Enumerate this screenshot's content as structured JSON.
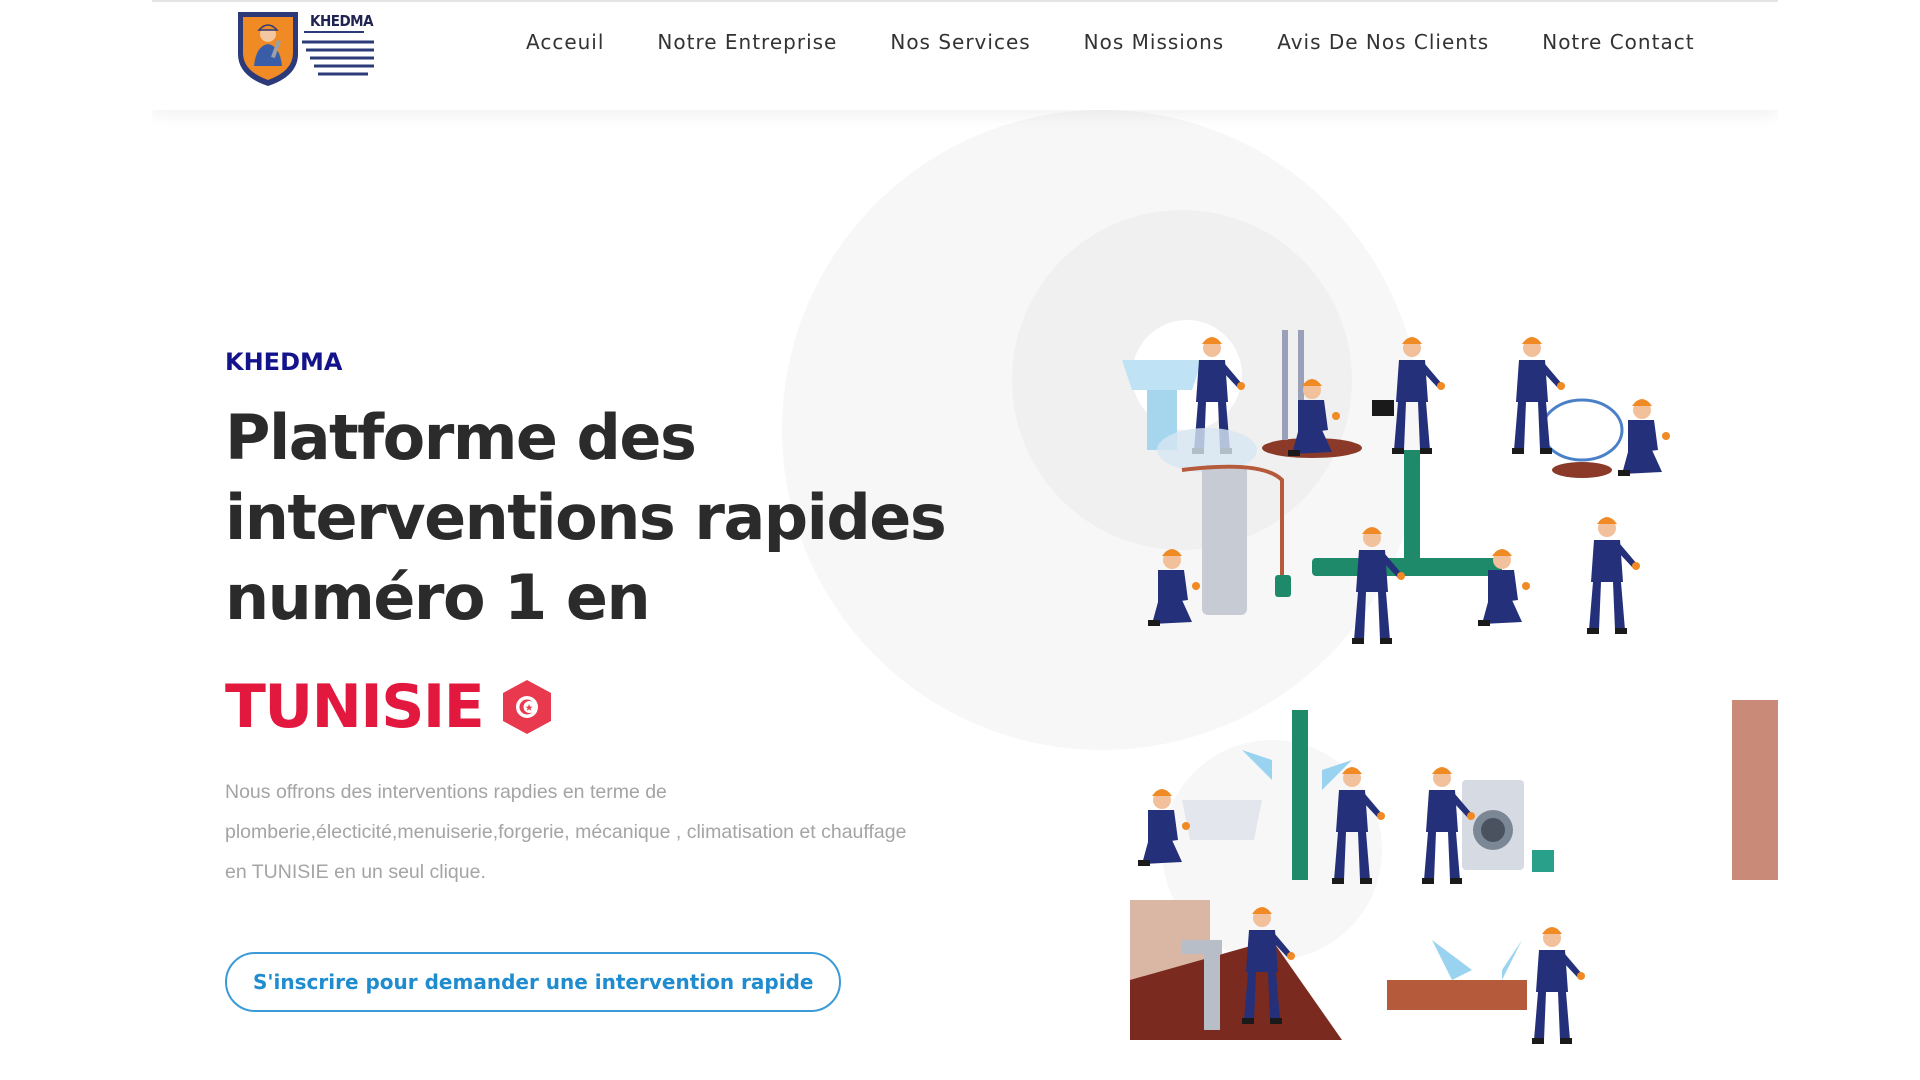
{
  "header": {
    "logo_text": "KHEDMA",
    "nav": [
      {
        "label": "Acceuil"
      },
      {
        "label": "Notre Entreprise"
      },
      {
        "label": "Nos Services"
      },
      {
        "label": "Nos Missions"
      },
      {
        "label": "Avis De Nos Clients"
      },
      {
        "label": "Notre Contact"
      }
    ]
  },
  "hero": {
    "eyebrow": "KHEDMA",
    "headline_lines": [
      "Platforme des",
      "interventions rapides",
      "numéro 1 en"
    ],
    "country": "TUNISIE",
    "description": "Nous offrons des interventions rapdies en terme de plomberie,électicité,menuiserie,forgerie, mécanique , climatisation et chauffage en TUNISIE en un seul clique.",
    "cta_label": "S'inscrire pour demander une intervention rapide",
    "flag_icon": "tunisia-flag-icon"
  },
  "colors": {
    "eyebrow": "#13148c",
    "headline": "#2b2b2b",
    "country": "#e3183f",
    "cta": "#1f8cd0",
    "worker_uniform": "#25307a",
    "helmet": "#f08a24"
  }
}
